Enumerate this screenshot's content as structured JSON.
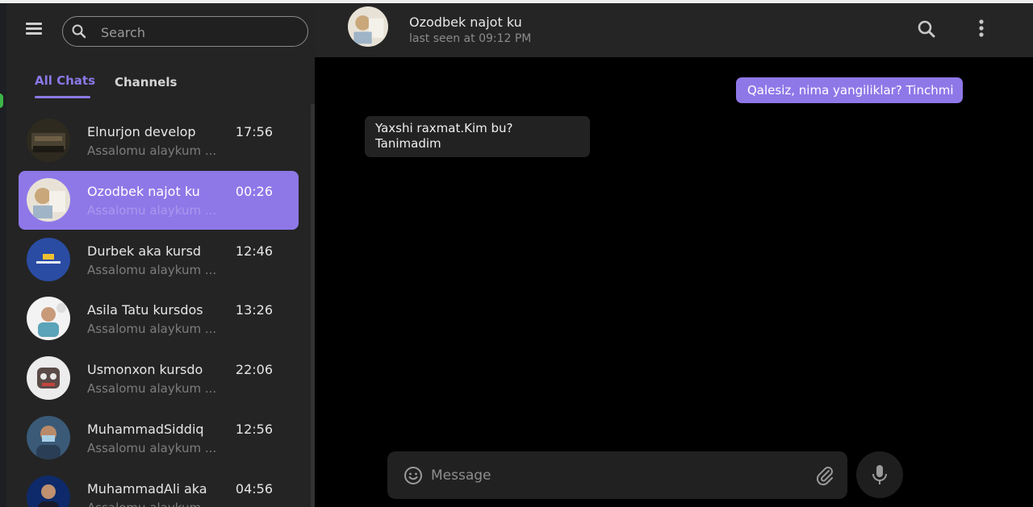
{
  "sidebar": {
    "search_placeholder": "Search",
    "tabs": [
      {
        "label": "All Chats",
        "active": true
      },
      {
        "label": "Channels",
        "active": false
      }
    ],
    "chats": [
      {
        "name": "Elnurjon develop",
        "preview": "Assalomu alaykum ...",
        "time": "17:56",
        "active": false
      },
      {
        "name": "Ozodbek najot ku",
        "preview": "Assalomu alaykum ...",
        "time": "00:26",
        "active": true
      },
      {
        "name": "Durbek aka kursd",
        "preview": "Assalomu alaykum ...",
        "time": "12:46",
        "active": false
      },
      {
        "name": "Asila Tatu kursdos",
        "preview": "Assalomu alaykum ...",
        "time": "13:26",
        "active": false
      },
      {
        "name": "Usmonxon kursdo",
        "preview": "Assalomu alaykum ...",
        "time": "22:06",
        "active": false
      },
      {
        "name": "MuhammadSiddiq",
        "preview": "Assalomu alaykum ...",
        "time": "12:56",
        "active": false
      },
      {
        "name": "MuhammadAli aka",
        "preview": "Assalomu alaykum ...",
        "time": "04:56",
        "active": false
      }
    ]
  },
  "header": {
    "name": "Ozodbek najot ku",
    "status": "last seen at 09:12 PM"
  },
  "messages": [
    {
      "direction": "out",
      "text": "Qalesiz, nima yangiliklar? Tinchmi"
    },
    {
      "direction": "in",
      "text": "Yaxshi raxmat.Kim bu? Tanimadim"
    }
  ],
  "composer": {
    "placeholder": "Message"
  },
  "colors": {
    "accent": "#8e78e8",
    "sidebar_bg": "#242424",
    "chat_bg": "#000000",
    "header_bg": "#252525"
  },
  "icons": [
    "menu-icon",
    "search-icon",
    "more-vertical-icon",
    "emoji-icon",
    "paperclip-icon",
    "microphone-icon"
  ]
}
